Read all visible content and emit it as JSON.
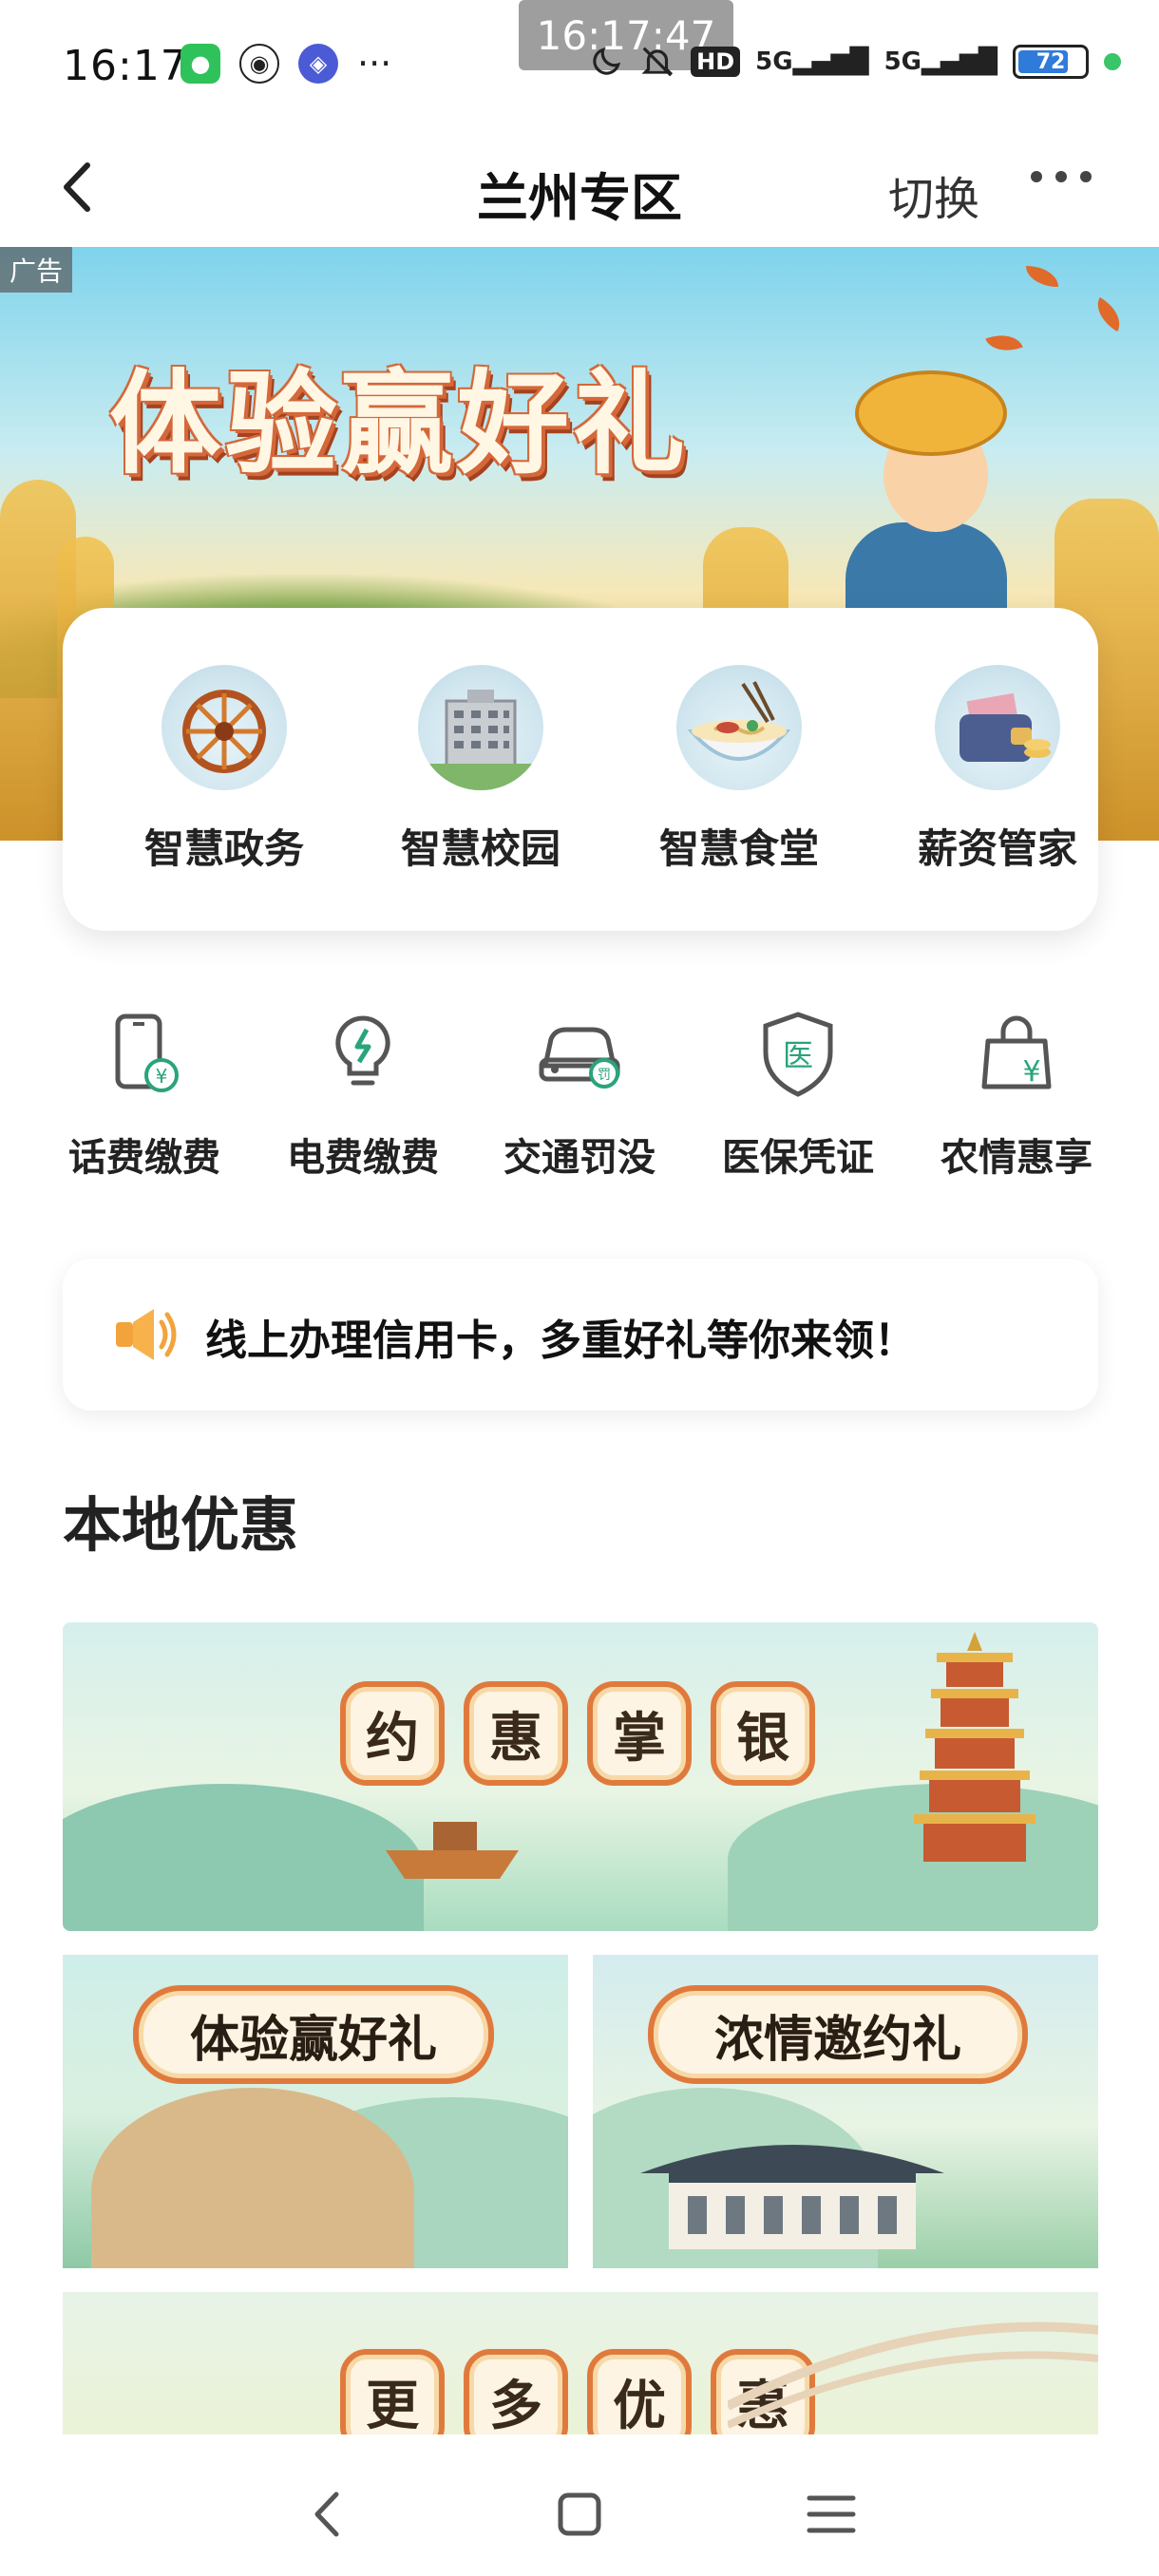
{
  "status_bar": {
    "time": "16:17",
    "overlay_time": "16:17:47",
    "app_icons": [
      "wechat-icon",
      "qq-icon",
      "tieba-icon"
    ],
    "more": "···",
    "hd": "HD",
    "signal_1": "5G",
    "signal_2": "5G",
    "battery": "72"
  },
  "nav": {
    "title": "兰州专区",
    "switch_label": "切换"
  },
  "banner": {
    "ad_tag": "广告",
    "headline": "体验赢好礼"
  },
  "quick_entries": [
    {
      "label": "智慧政务",
      "icon": "waterwheel-icon"
    },
    {
      "label": "智慧校园",
      "icon": "campus-building-icon"
    },
    {
      "label": "智慧食堂",
      "icon": "noodle-bowl-icon"
    },
    {
      "label": "薪资管家",
      "icon": "wallet-icon"
    }
  ],
  "services": [
    {
      "label": "话费缴费",
      "icon": "phone-bill-icon"
    },
    {
      "label": "电费缴费",
      "icon": "lightbulb-icon"
    },
    {
      "label": "交通罚没",
      "icon": "car-fine-icon"
    },
    {
      "label": "医保凭证",
      "icon": "medical-shield-icon"
    },
    {
      "label": "农情惠享",
      "icon": "shopping-bag-icon"
    }
  ],
  "notice": {
    "text": "线上办理信用卡，多重好礼等你来领！"
  },
  "local_deals": {
    "title": "本地优惠",
    "big_banner_chars": [
      "约",
      "惠",
      "掌",
      "银"
    ],
    "left_card": "体验赢好礼",
    "right_card": "浓情邀约礼",
    "more_chars": [
      "更",
      "多",
      "优",
      "惠"
    ]
  },
  "colors": {
    "accent_orange": "#e07a3c",
    "brand_green": "#2aa47a"
  }
}
